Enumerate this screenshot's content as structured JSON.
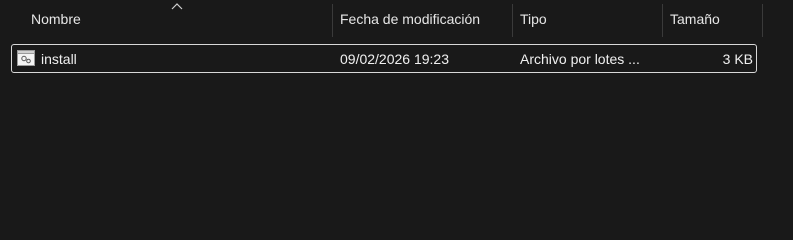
{
  "columns": {
    "name": "Nombre",
    "modified": "Fecha de modificación",
    "type": "Tipo",
    "size": "Tamaño"
  },
  "sort": {
    "column": "name",
    "direction": "ascending",
    "icon": "sort-up-icon"
  },
  "files": [
    {
      "name": "install",
      "modified": "09/02/2026 19:23",
      "type": "Archivo por lotes ...",
      "size": "3 KB",
      "icon": "batch-file-icon",
      "selected": true
    }
  ],
  "colors": {
    "background": "#191919",
    "text": "#ffffff",
    "selection_border": "#d8d8d8",
    "separator": "#3a3a3a"
  }
}
